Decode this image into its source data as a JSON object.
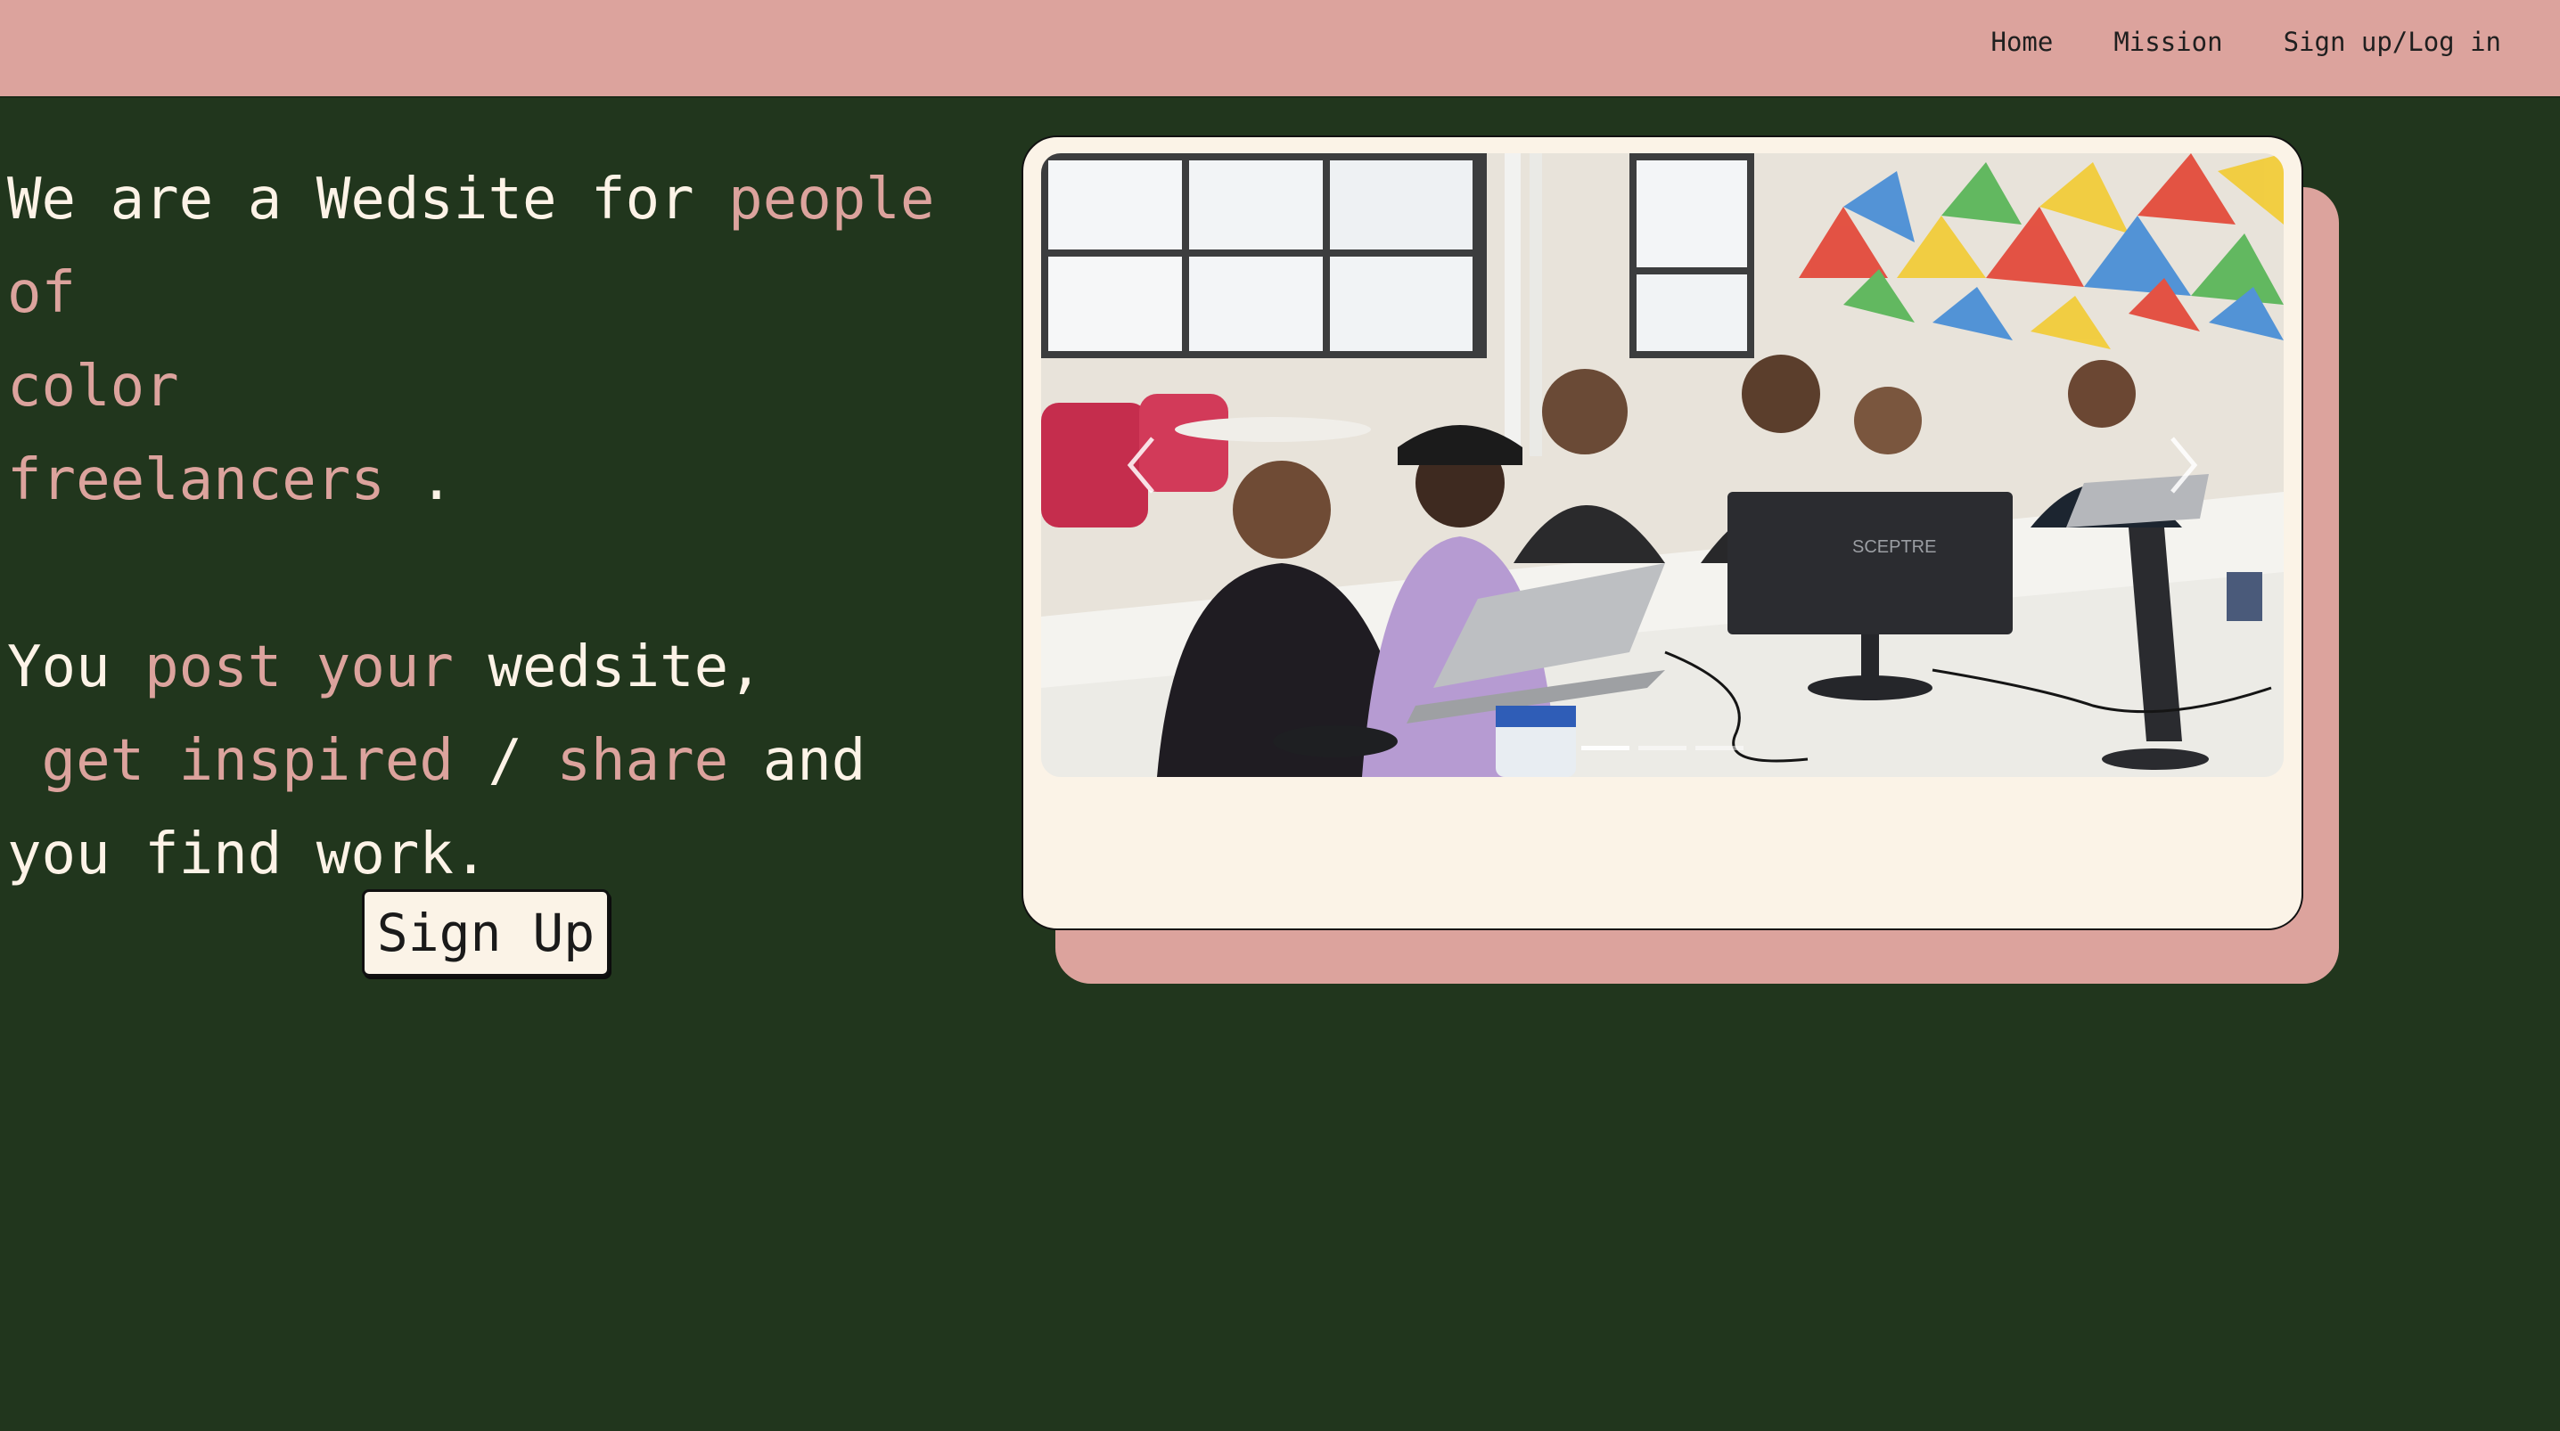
{
  "nav": {
    "links": [
      "Home",
      "Mission",
      "Sign up/Log in"
    ]
  },
  "hero": {
    "line1_text": "We are a Wedsite for ",
    "line1_accent": "people of",
    "line2_accent": "color",
    "line3_accent": "freelancers",
    "line3_text": " .",
    "line4_text_a": "You ",
    "line4_accent": "post your",
    "line4_text_b": " wedsite,",
    "line5_accent_a": " get inspired",
    "line5_text_a": " / ",
    "line5_accent_b": "share",
    "line5_text_b": " and",
    "line6_text": "you find work."
  },
  "signup_button": "Sign Up",
  "carousel": {
    "image_subject": "group of people at tables with laptops and monitors",
    "prev_icon": "chevron-left-icon",
    "next_icon": "chevron-right-icon",
    "monitor_brand": "SCEPTRE",
    "slides_count": 3,
    "active_slide": 1
  },
  "colors": {
    "background": "#21361d",
    "navbar": "#dca39d",
    "accent_text": "#dca39d",
    "card": "#fbf3e7",
    "primary_text": "#fdf3e7"
  }
}
